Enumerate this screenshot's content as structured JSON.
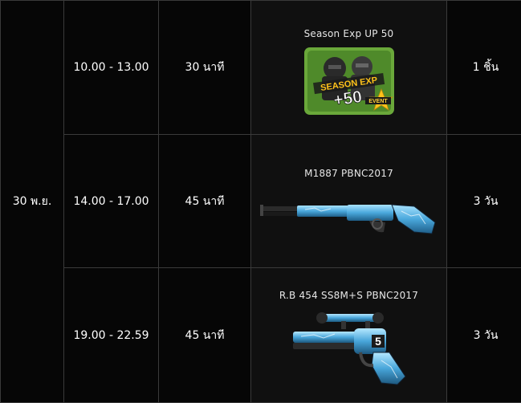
{
  "date": "30 พ.ย.",
  "rows": [
    {
      "time": "10.00 - 13.00",
      "duration": "30 นาที",
      "item_name": "Season Exp UP 50",
      "badge": {
        "line1": "SEASON EXP",
        "line2": "+50",
        "tag": "EVENT"
      },
      "icon": "season-exp-badge-icon",
      "quantity": "1 ชิ้น"
    },
    {
      "time": "14.00 - 17.00",
      "duration": "45 นาที",
      "item_name": "M1887 PBNC2017",
      "icon": "shotgun-icon",
      "quantity": "3 วัน"
    },
    {
      "time": "19.00 - 22.59",
      "duration": "45 นาที",
      "item_name": "R.B 454 SS8M+S PBNC2017",
      "icon": "revolver-icon",
      "quantity": "3 วัน"
    }
  ],
  "colors": {
    "background": "#060606",
    "border": "#3a3a3a",
    "item_cell": "#101010",
    "badge_green": "#6aa83a",
    "weapon_blue": "#5ab8e6"
  }
}
